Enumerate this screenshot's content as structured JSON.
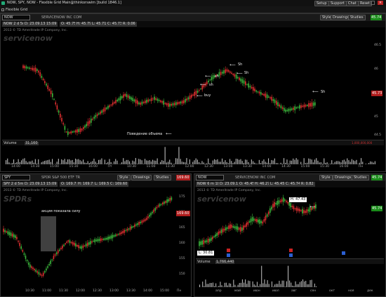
{
  "window": {
    "title": "NOW, SPY, NOW - Flexible Grid Main@thinkorswim [build 1846.1]",
    "buttons": [
      "Setup",
      "Support",
      "Chat",
      "Reset"
    ],
    "grid_label": "Flexible Grid"
  },
  "top": {
    "symbol": "NOW",
    "symbol_desc": "SERVICENOW INC COM",
    "timeframe": "NOW 2 d 5m",
    "ohlc": [
      "D: 23.09.13 15:09",
      "O: 45.75",
      "H: 45.79",
      "L: 45.71",
      "C: 45.73",
      "R: 0.06"
    ],
    "copyright": "2013 © TD Ameritrade IP Company, Inc.",
    "price": "45.74",
    "price_tag": "45.73",
    "style_label": "Style",
    "drawings_label": "Drawings",
    "studies_label": "Studies",
    "watermark": "servicenow",
    "annotations": {
      "buy": "buy",
      "sh1": "sh",
      "sh2": "sh",
      "sh3": "Sh",
      "sh4": "Sh",
      "sh5": "Sh",
      "volume_note": "Поведение объема"
    },
    "y_labels": [
      "46.5",
      "46",
      "45.5",
      "45",
      "44.5"
    ],
    "volume_label": "Volume",
    "volume_value": "31,160",
    "volume_right": "1,000,000,000",
    "x_labels": [
      "14:00",
      "14:30",
      "15:00",
      "15:30",
      "16:00",
      "Пт",
      "10:30",
      "11:00",
      "11:30",
      "12:00",
      "12:30",
      "13:00",
      "13:30",
      "14:00",
      "14:30",
      "15:00",
      "15:30",
      "16:00",
      "Пн"
    ]
  },
  "bottom_left": {
    "symbol": "SPY",
    "symbol_desc": "SPDR S&P 500 ETF TR",
    "timeframe": "SPY 2 d 5m",
    "ohlc": [
      "D: 23.09.13 15:09",
      "O: 169.73",
      "H: 169.75",
      "L: 169.59",
      "C: 169.60"
    ],
    "copyright": "2013 © TD Ameritrade IP Company, Inc.",
    "price": "169.60",
    "watermark": "SPDRs",
    "annotation": "акция показала силу",
    "style_label": "Style",
    "drawings_label": "Drawings",
    "studies_label": "Studies",
    "y_labels": [
      "175",
      "170",
      "165",
      "160",
      "155",
      "150"
    ],
    "x_labels": [
      "10:30",
      "11:00",
      "11:30",
      "12:00",
      "12:30",
      "13:00",
      "13:30",
      "14:00",
      "15:00",
      "Пн"
    ]
  },
  "bottom_right": {
    "symbol": "NOW",
    "symbol_desc": "SERVICENOW INC COM",
    "timeframe": "NOW 6 m 1D",
    "ohlc": [
      "D: 23.09.13",
      "O: 45.45",
      "H: 46.27",
      "L: 45.45",
      "C: 45.74",
      "R: 0.82"
    ],
    "copyright": "2013 © TD Ameritrade IP Company, Inc.",
    "price": "45.74",
    "watermark": "servicenow",
    "hi_label": "H: 47.43",
    "lo_label": "L: 30.81",
    "style_label": "Style",
    "drawings_label": "Drawings",
    "studies_label": "Studies",
    "volume_label": "Volume",
    "volume_value": "1,766,440",
    "x_labels": [
      "апр",
      "май",
      "июн",
      "июл",
      "авг",
      "сен",
      "окт",
      "ноя",
      "дек"
    ]
  },
  "colors": {
    "up": "#3cb83c",
    "down": "#e03030",
    "accent": "#4aa8ff",
    "price_green": "#1a8c1a"
  }
}
